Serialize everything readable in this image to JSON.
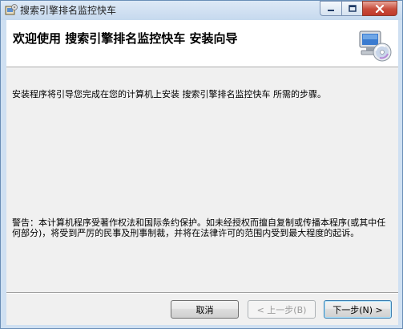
{
  "window": {
    "title": "搜索引擎排名监控快车",
    "caption": {
      "minimize": "minimize",
      "maximize": "maximize",
      "close": "close"
    }
  },
  "header": {
    "title": "欢迎使用  搜索引擎排名监控快车  安装向导",
    "icon": "computer-cd-icon"
  },
  "body": {
    "intro": "安装程序将引导您完成在您的计算机上安装 搜索引擎排名监控快车 所需的步骤。",
    "warning": "警告：本计算机程序受著作权法和国际条约保护。如未经授权而擅自复制或传播本程序(或其中任何部分)，将受到严厉的民事及刑事制裁，并将在法律许可的范围内受到最大程度的起诉。"
  },
  "buttons": {
    "cancel": "取消",
    "back": "< 上一步(B)",
    "next": "下一步(N) >"
  },
  "colors": {
    "accent": "#3c7fb1",
    "close": "#c84c3a",
    "frame": "#cfe0f2"
  }
}
